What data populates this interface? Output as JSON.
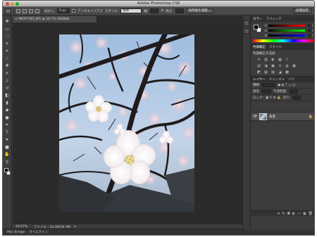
{
  "window": {
    "title": "Adobe Photoshop CS6"
  },
  "options_bar": {
    "feather_label": "ぼかし:",
    "feather_value": "0 px",
    "antialias_label": "アンチエイリアス",
    "style_label": "スタイル:",
    "style_value": "標準",
    "width_label": "幅:",
    "height_label": "高さ:",
    "refine_edge_button": "境界線を調整...",
    "workspace_button": "初期設定"
  },
  "tools": [
    {
      "name": "move-tool-icon",
      "glyph": "✥"
    },
    {
      "name": "marquee-tool-icon",
      "glyph": "▭"
    },
    {
      "name": "lasso-tool-icon",
      "glyph": "◌"
    },
    {
      "name": "quick-select-tool-icon",
      "glyph": "✎"
    },
    {
      "name": "crop-tool-icon",
      "glyph": "⌗"
    },
    {
      "name": "eyedropper-tool-icon",
      "glyph": "⟋"
    },
    {
      "name": "healing-tool-icon",
      "glyph": "✚"
    },
    {
      "name": "brush-tool-icon",
      "glyph": "✐"
    },
    {
      "name": "clone-stamp-tool-icon",
      "glyph": "⊥"
    },
    {
      "name": "history-brush-tool-icon",
      "glyph": "↺"
    },
    {
      "name": "eraser-tool-icon",
      "glyph": "◧"
    },
    {
      "name": "gradient-tool-icon",
      "glyph": "▮"
    },
    {
      "name": "blur-tool-icon",
      "glyph": "◆"
    },
    {
      "name": "dodge-tool-icon",
      "glyph": "●"
    },
    {
      "name": "pen-tool-icon",
      "glyph": "✒"
    },
    {
      "name": "type-tool-icon",
      "glyph": "T"
    },
    {
      "name": "path-select-tool-icon",
      "glyph": "➤"
    },
    {
      "name": "shape-tool-icon",
      "glyph": "■"
    },
    {
      "name": "hand-tool-icon",
      "glyph": "✋"
    },
    {
      "name": "zoom-tool-icon",
      "glyph": "⚲"
    }
  ],
  "document": {
    "tab_title": "IMGP7361.JPG @ 16.7% (RGB/8)",
    "zoom": "16.67%",
    "file_info": "ファイル : 34.3M/34.3M"
  },
  "mini_bridge": {
    "tab1": "Mini Bridge",
    "tab2": "タイムライン"
  },
  "color_panel": {
    "tab_color": "カラー",
    "tab_swatches": "スウォッチ",
    "r_label": "R",
    "g_label": "G",
    "b_label": "B",
    "r_value": "0",
    "g_value": "0",
    "b_value": "0"
  },
  "adjustments_panel": {
    "tab_adjust": "色調補正",
    "tab_styles": "スタイル",
    "heading": "色調補正を追加",
    "row1": [
      "☀",
      "▥",
      "◐",
      "▦",
      "▽"
    ],
    "row2": [
      "▤",
      "◑",
      "▣",
      "⊙",
      "◍",
      "▦"
    ],
    "row3": [
      "◩",
      "▧",
      "▨",
      "◪",
      "▩"
    ]
  },
  "layers_panel": {
    "tab_layers": "レイヤー",
    "tab_channels": "チャンネル",
    "tab_paths": "パス",
    "kind_label": "種類",
    "blend_mode": "通常",
    "opacity_label": "不透明度:",
    "lock_label": "ロック:",
    "fill_label": "塗り:",
    "layer_name": "背景",
    "footer_icons": [
      "ɞ",
      "fx",
      "◘",
      "◐",
      "▭",
      "▣",
      "🗑"
    ]
  }
}
